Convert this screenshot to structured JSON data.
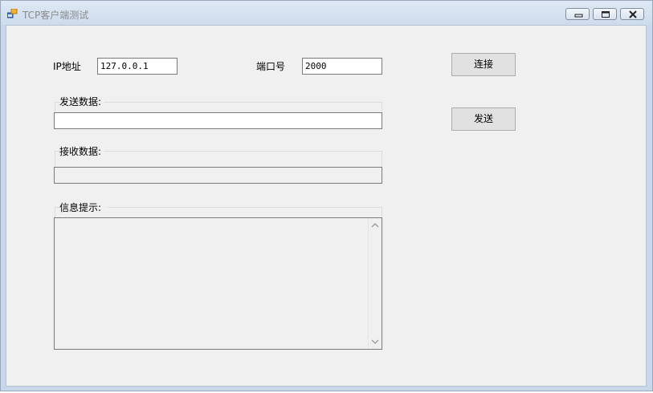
{
  "window": {
    "title": "TCP客户端测试",
    "icon": "app-window-icon",
    "controls": {
      "minimize_icon": "minimize-icon",
      "restore_icon": "restore-icon",
      "close_icon": "close-icon"
    }
  },
  "form": {
    "ip_label": "IP地址",
    "ip_value": "127.0.0.1",
    "port_label": "端口号",
    "port_value": "2000",
    "connect_button": "连接",
    "send_button": "发送",
    "send_group_label": "发送数据:",
    "send_value": "",
    "receive_group_label": "接收数据:",
    "receive_value": "",
    "info_group_label": "信息提示:",
    "info_value": ""
  },
  "colors": {
    "client_background": "#f0f0f0",
    "titlebar": "#d6e2f0",
    "button_face": "#e1e1e1"
  }
}
